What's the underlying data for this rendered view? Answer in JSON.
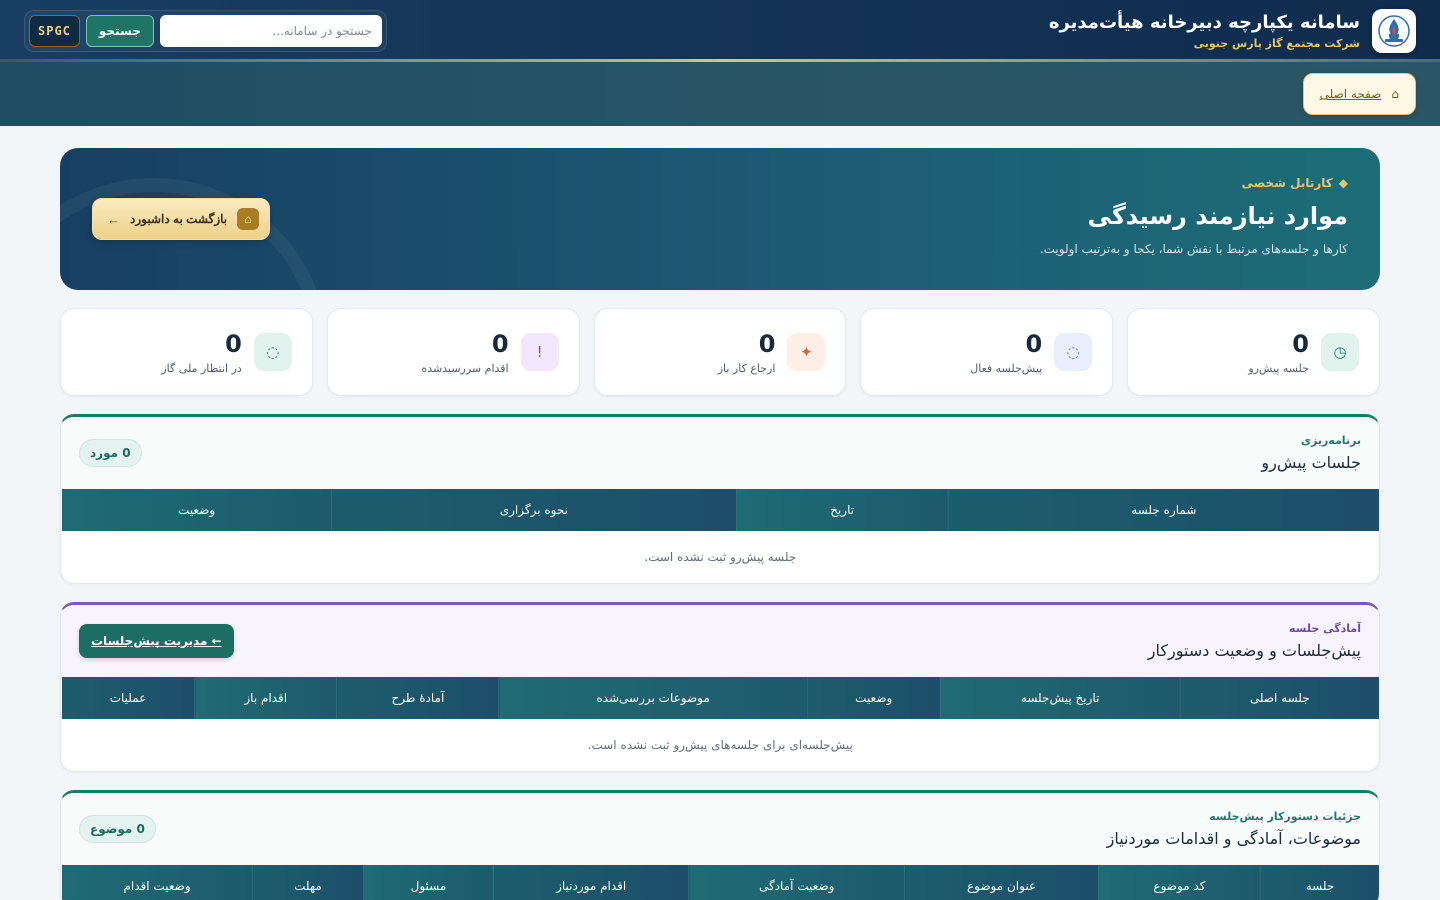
{
  "header": {
    "title": "سامانه یکپارچه دبیرخانه هیأت‌مدیره",
    "subtitle": "شرکت مجتمع گاز پارس جنوبی",
    "search_placeholder": "جستجو در سامانه...",
    "search_button": "جستجو",
    "spgc_button": "SPGC",
    "home_link": "صفحه اصلی",
    "home_icon": "⌂"
  },
  "hero": {
    "eyebrow_icon": "◆",
    "eyebrow": "کارتابل شخصی",
    "title": "موارد نیازمند رسیدگی",
    "description": "کارها و جلسه‌های مرتبط با نقش شما، یکجا و به‌ترتیب اولویت.",
    "back_button": "بازگشت به داشبورد",
    "back_icon": "⌂",
    "back_arrow": "←"
  },
  "stats": [
    {
      "value": "0",
      "label": "جلسه پیش‌رو",
      "icon": "◷",
      "icon_color": "#1e7a6c",
      "icon_bg": "#e2f3ee"
    },
    {
      "value": "0",
      "label": "پیش‌جلسه فعال",
      "icon": "◌",
      "icon_color": "#5a7bd0",
      "icon_bg": "#e8eefc"
    },
    {
      "value": "0",
      "label": "ارجاع کار باز",
      "icon": "✦",
      "icon_color": "#d9643a",
      "icon_bg": "#fdeee6"
    },
    {
      "value": "0",
      "label": "اقدام سررسیدشده",
      "icon": "!",
      "icon_color": "#8a4ad0",
      "icon_bg": "#f1e8fc"
    },
    {
      "value": "0",
      "label": "در انتظار ملی گاز",
      "icon": "◌",
      "icon_color": "#1e7a6c",
      "icon_bg": "#e2f3ee"
    }
  ],
  "upcoming": {
    "eyebrow": "برنامه‌ریزی",
    "title": "جلسات پیش‌رو",
    "badge": "0 مورد",
    "columns": [
      "شماره جلسه",
      "تاریخ",
      "نحوه برگزاری",
      "وضعیت"
    ],
    "empty": "جلسه پیش‌رو ثبت نشده است."
  },
  "presessions": {
    "eyebrow": "آمادگی جلسه",
    "title": "پیش‌جلسات و وضعیت دستورکار",
    "manage_button": "← مدیریت پیش‌جلسات",
    "columns": [
      "جلسه اصلی",
      "تاریخ پیش‌جلسه",
      "وضعیت",
      "موضوعات بررسی‌شده",
      "آمادهٔ طرح",
      "اقدام باز",
      "عملیات"
    ],
    "empty": "پیش‌جلسه‌ای برای جلسه‌های پیش‌رو ثبت نشده است."
  },
  "agenda": {
    "eyebrow": "جزئیات دستورکار پیش‌جلسه",
    "title": "موضوعات، آمادگی و اقدامات موردنیاز",
    "badge": "0 موضوع",
    "columns": [
      "جلسه",
      "کد موضوع",
      "عنوان موضوع",
      "وضعیت آمادگی",
      "اقدام موردنیاز",
      "مسئول",
      "مهلت",
      "وضعیت اقدام"
    ]
  }
}
